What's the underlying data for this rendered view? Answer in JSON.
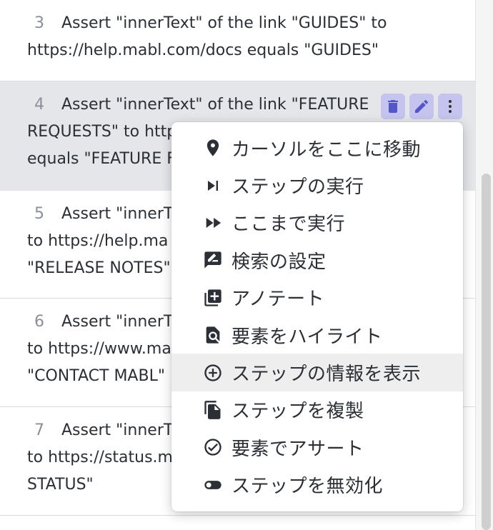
{
  "steps": [
    {
      "num": "3",
      "line1": "Assert \"innerText\" of the link \"GUIDES\" to",
      "line2": "https://help.mabl.com/docs equals \"GUIDES\"",
      "line3": ""
    },
    {
      "num": "4",
      "line1": "Assert \"innerText\" of the link \"FEATURE",
      "line2": "REQUESTS\" to http",
      "line3": "equals \"FEATURE F"
    },
    {
      "num": "5",
      "line1": "Assert \"innerT",
      "line2": "to https://help.ma",
      "line3": "\"RELEASE NOTES\""
    },
    {
      "num": "6",
      "line1": "Assert \"innerT",
      "line2": "to https://www.ma",
      "line3": "\"CONTACT MABL\""
    },
    {
      "num": "7",
      "line1": "Assert \"innerT",
      "line2": "to https://status.m",
      "line3": "STATUS\""
    }
  ],
  "actions": {
    "delete_icon": "trash-icon",
    "edit_icon": "pencil-icon",
    "more_icon": "more-vertical-icon",
    "accent_color": "#c4c4ee",
    "icon_color": "#5355c9"
  },
  "menu": {
    "items": [
      {
        "label": "カーソルをここに移動",
        "icon": "location-pin-icon"
      },
      {
        "label": "ステップの実行",
        "icon": "skip-next-icon"
      },
      {
        "label": "ここまで実行",
        "icon": "fast-forward-icon"
      },
      {
        "label": "検索の設定",
        "icon": "rate-review-icon"
      },
      {
        "label": "アノテート",
        "icon": "library-add-icon"
      },
      {
        "label": "要素をハイライト",
        "icon": "find-in-page-icon"
      },
      {
        "label": "ステップの情報を表示",
        "icon": "add-circle-icon",
        "highlighted": true
      },
      {
        "label": "ステップを複製",
        "icon": "file-copy-icon"
      },
      {
        "label": "要素でアサート",
        "icon": "check-circle-icon"
      },
      {
        "label": "ステップを無効化",
        "icon": "toggle-off-icon"
      }
    ]
  }
}
